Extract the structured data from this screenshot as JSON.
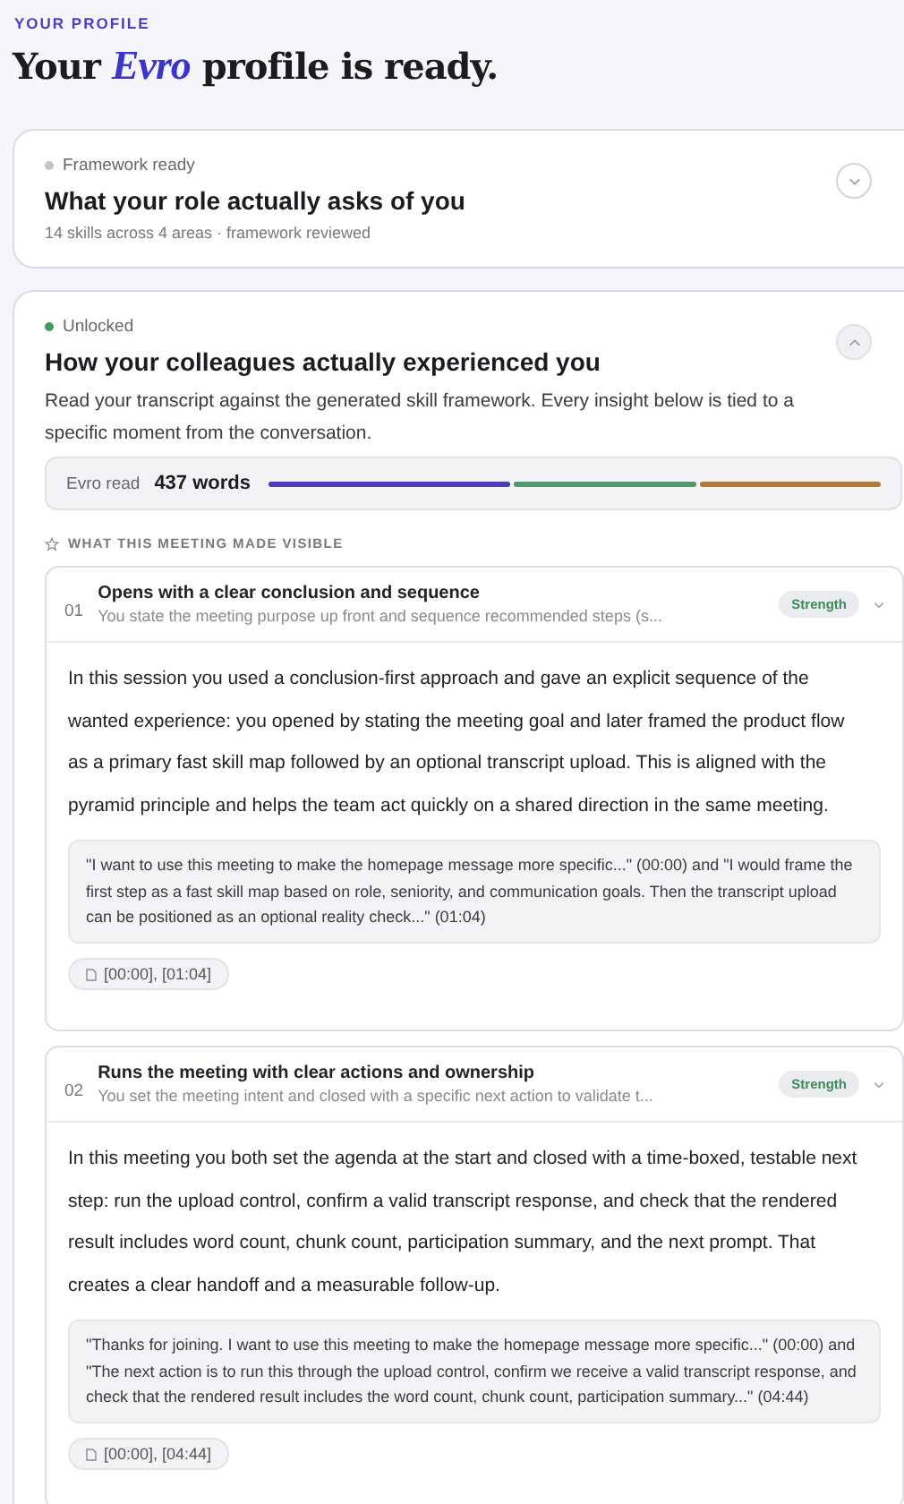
{
  "eyebrow": "YOUR PROFILE",
  "headline": "Your *Evro* profile is ready.",
  "sections": [
    {
      "status": "Framework ready",
      "color": "#c4c4cc",
      "title": "What your role actually asks of you",
      "meta": "14 skills across 4 areas · framework reviewed",
      "expanded": false
    },
    {
      "status": "Unlocked",
      "color": "#3f9a5e",
      "title": "How your colleagues actually experienced you",
      "description": "Read your transcript against the generated skill framework. Every insight below is tied to a specific moment from the conversation.",
      "expanded": true,
      "read": {
        "label": "Evro read",
        "count": "437 words",
        "segments": [
          {
            "color": "#4b3bb5"
          },
          {
            "color": "#4e9a6e"
          },
          {
            "color": "#b07a3a"
          }
        ]
      },
      "insights_heading": "WHAT THIS MEETING MADE VISIBLE",
      "insights": [
        {
          "number": "01",
          "title": "Opens with a clear conclusion and sequence",
          "summary": "You state the meeting purpose up front and sequence recommended steps (s...",
          "badge": "Strength",
          "body": "In this session you used a conclusion-first approach and gave an explicit sequence of the wanted experience: you opened by stating the meeting goal and later framed the product flow as a primary fast skill map followed by an optional transcript upload. This is aligned with the pyramid principle and helps the team act quickly on a shared direction in the same meeting.",
          "quote": "\"I want to use this meeting to make the homepage message more specific...\" (00:00) and \"I would frame the first step as a fast skill map based on role, seniority, and communication goals. Then the transcript upload can be positioned as an optional reality check...\" (01:04)",
          "timestamps": "[00:00], [01:04]"
        },
        {
          "number": "02",
          "title": "Runs the meeting with clear actions and ownership",
          "summary": "You set the meeting intent and closed with a specific next action to validate t...",
          "badge": "Strength",
          "body": "In this meeting you both set the agenda at the start and closed with a time-boxed, testable next step: run the upload control, confirm a valid transcript response, and check that the rendered result includes word count, chunk count, participation summary, and the next prompt. That creates a clear handoff and a measurable follow-up.",
          "quote": "\"Thanks for joining. I want to use this meeting to make the homepage message more specific...\" (00:00) and \"The next action is to run this through the upload control, confirm we receive a valid transcript response, and check that the rendered result includes the word count, chunk count, participation summary...\" (04:44)",
          "timestamps": "[00:00], [04:44]"
        }
      ]
    }
  ]
}
